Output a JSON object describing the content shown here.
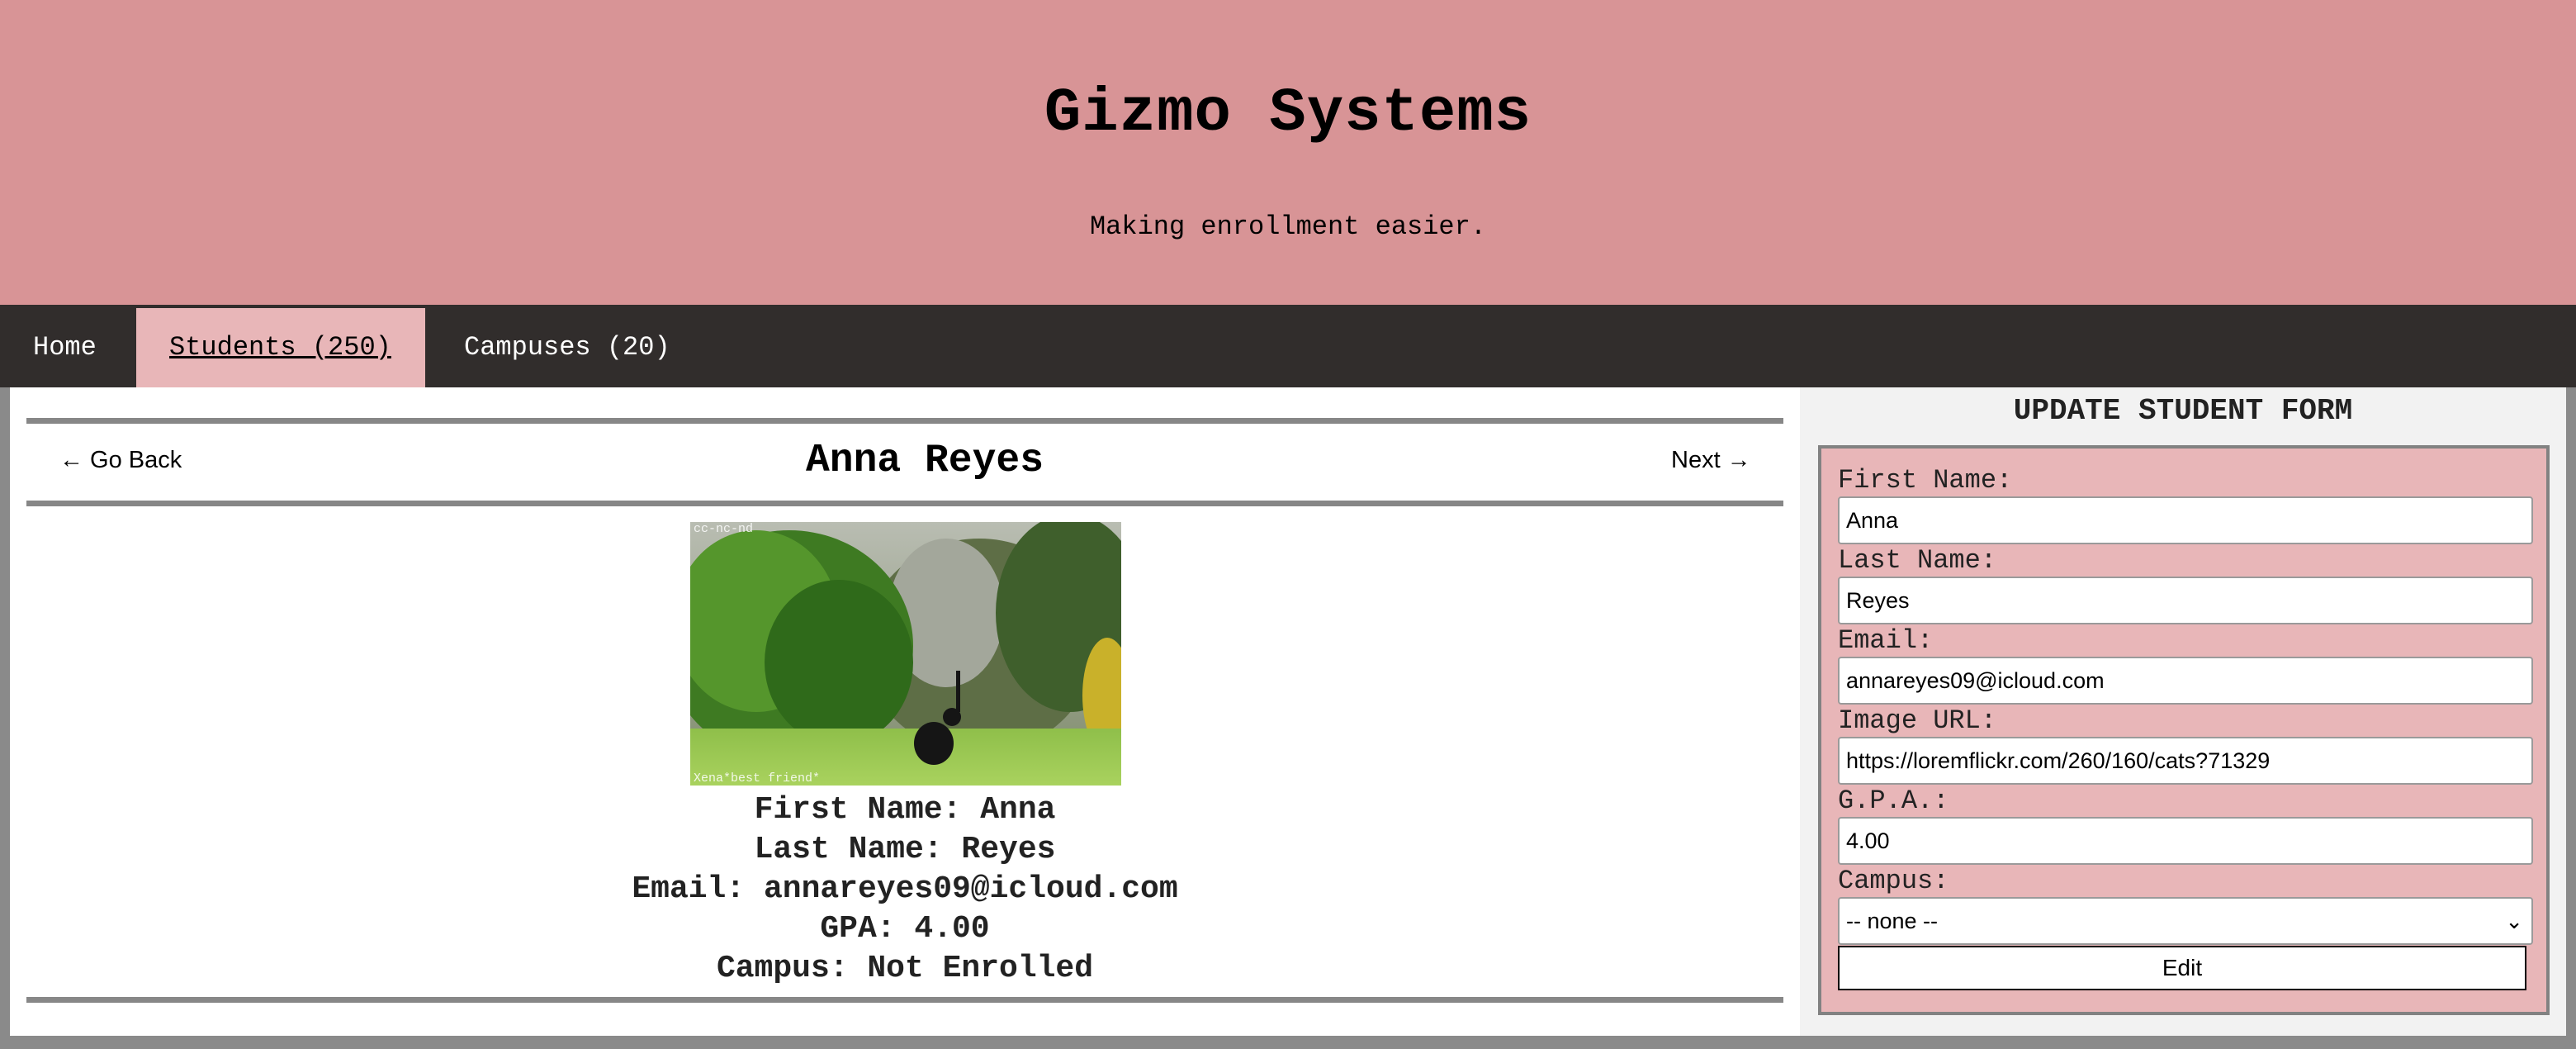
{
  "header": {
    "title": "Gizmo Systems",
    "tagline": "Making enrollment easier."
  },
  "nav": {
    "items": [
      {
        "label": "Home",
        "active": false
      },
      {
        "label": "Students (250)",
        "active": true
      },
      {
        "label": "Campuses (20)",
        "active": false
      }
    ]
  },
  "student": {
    "go_back": "← Go Back",
    "next": "Next →",
    "name": "Anna Reyes",
    "photo_watermark_top": "cc-nc-nd",
    "photo_watermark_bottom": "Xena*best friend*",
    "first_name_line": "First Name: Anna",
    "last_name_line": "Last Name: Reyes",
    "email_line": "Email: annareyes09@icloud.com",
    "gpa_line": "GPA: 4.00",
    "campus_line": "Campus: Not Enrolled"
  },
  "form": {
    "title": "UPDATE STUDENT FORM",
    "first_name_label": "First Name:",
    "first_name_value": "Anna",
    "last_name_label": "Last Name:",
    "last_name_value": "Reyes",
    "email_label": "Email:",
    "email_value": "annareyes09@icloud.com",
    "image_url_label": "Image URL:",
    "image_url_value": "https://loremflickr.com/260/160/cats?71329",
    "gpa_label": "G.P.A.:",
    "gpa_value": "4.00",
    "campus_label": "Campus:",
    "campus_selected": "-- none --",
    "submit_label": "Edit"
  },
  "colors": {
    "banner": "#d89496",
    "nav_bg": "#312d2c",
    "active_tab": "#e8b6b8",
    "form_bg": "#e8b6b8"
  }
}
